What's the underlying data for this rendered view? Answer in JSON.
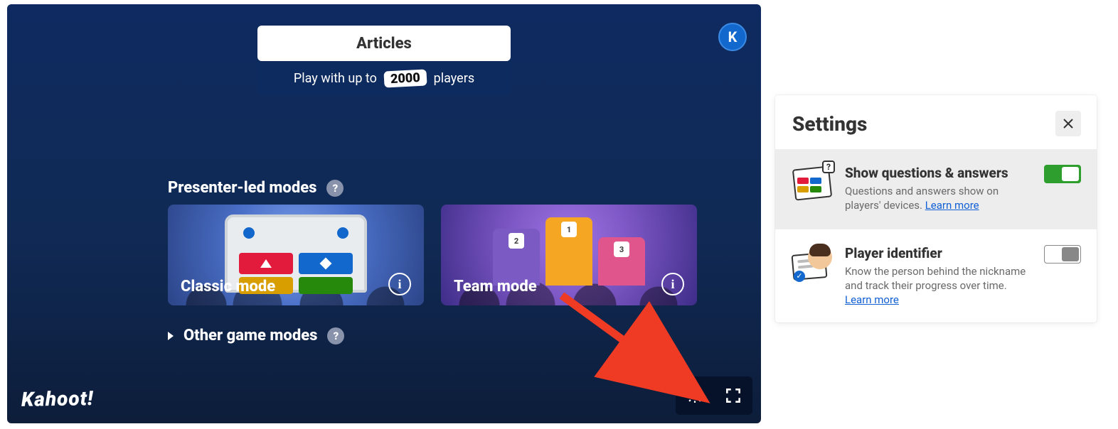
{
  "header": {
    "title": "Articles",
    "play_prefix": "Play with up to",
    "player_count": "2000",
    "play_suffix": "players"
  },
  "avatar": {
    "initial": "K"
  },
  "sections": {
    "presenter_title": "Presenter-led modes",
    "other_title": "Other game modes"
  },
  "modes": {
    "classic": "Classic mode",
    "team": "Team mode"
  },
  "logo": "Kahoot!",
  "settings": {
    "title": "Settings",
    "rows": [
      {
        "title": "Show questions & answers",
        "desc": "Questions and answers show on players' devices.",
        "link": "Learn more",
        "on": true
      },
      {
        "title": "Player identifier",
        "desc": "Know the person behind the nickname and track their progress over time.",
        "link": "Learn more",
        "on": false
      }
    ]
  },
  "podium_ranks": {
    "p1": "1",
    "p2": "2",
    "p3": "3"
  }
}
